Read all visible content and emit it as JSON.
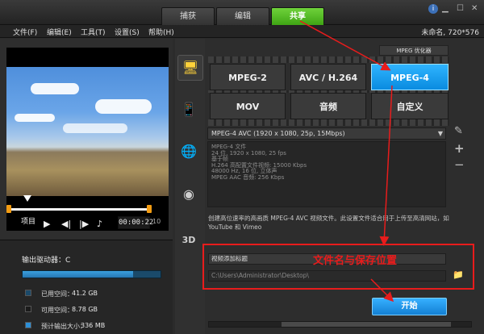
{
  "tabs": [
    {
      "label": "捕获"
    },
    {
      "label": "编辑"
    },
    {
      "label": "共享"
    }
  ],
  "menu": [
    {
      "label": "文件(F)"
    },
    {
      "label": "编辑(E)"
    },
    {
      "label": "工具(T)"
    },
    {
      "label": "设置(S)"
    },
    {
      "label": "帮助(H)"
    }
  ],
  "project": {
    "title": "未命名, 720*576"
  },
  "window_controls": {
    "help": "i"
  },
  "player": {
    "project_label": "项目",
    "timecode": "00:00:22",
    "timecode_ext": "10"
  },
  "drive": {
    "label": "输出驱动器：C",
    "used_fraction": 0.8,
    "legend": [
      {
        "label": "已用空间：",
        "value": "41.2 GB",
        "color": "#1b4a6a"
      },
      {
        "label": "可用空间：",
        "value": "8.78 GB",
        "color": "#1b1b1b"
      },
      {
        "label": "预计输出大小：",
        "value": "336 MB",
        "color": "#2d8fd6"
      }
    ]
  },
  "share": {
    "mpeg_optimizer": "MPEG 优化器",
    "formats": [
      {
        "label": "MPEG-2"
      },
      {
        "label": "AVC / H.264"
      },
      {
        "label": "MPEG-4"
      },
      {
        "label": "MOV"
      },
      {
        "label": "音频"
      },
      {
        "label": "自定义"
      }
    ],
    "selected_format": "MPEG-4",
    "profile": "MPEG-4 AVC (1920 x 1080, 25p, 15Mbps)",
    "details": [
      "MPEG-4 文件",
      "24 位, 1920 x 1080, 25 fps",
      "基于帧",
      "H.264 高配置文件视频: 15000 Kbps",
      "48000 Hz, 16 位, 立体声",
      "MPEG AAC 音频: 256 Kbps"
    ],
    "description": "创建高位速率的高画质 MPEG-4 AVC 视频文件。此设置文件适合用于上传至高清网站，如 YouTube 和 Vimeo",
    "file_name_placeholder": "视频添加标题",
    "file_path": "C:\\Users\\Administrator\\Desktop\\",
    "annotation": "文件名与保存位置",
    "start_label": "开始",
    "tool_add": "+",
    "tool_remove": "−",
    "tool_edit": "✎"
  }
}
